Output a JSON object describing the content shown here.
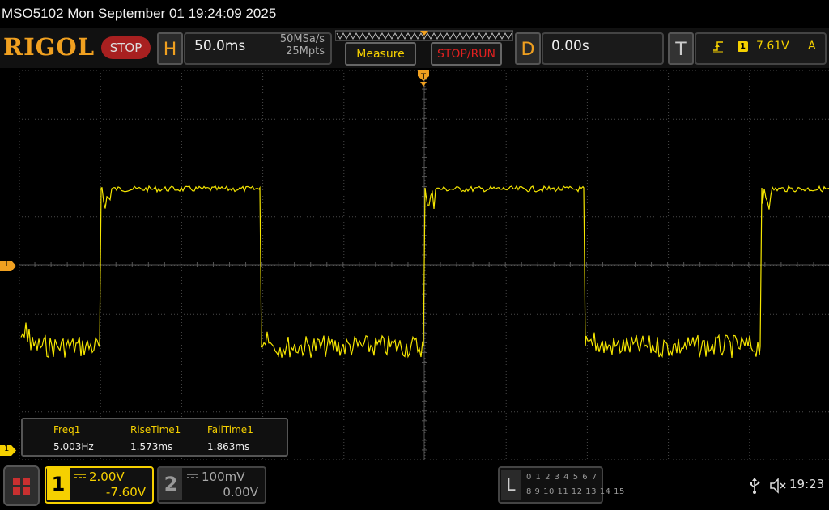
{
  "titlebar": {
    "text": "MSO5102  Mon September 01 19:24:09 2025"
  },
  "toolbar": {
    "logo": "RIGOL",
    "run_state": "STOP",
    "horizontal": {
      "key": "H",
      "timebase": "50.0ms",
      "sample_rate": "50MSa/s",
      "memory_depth": "25Mpts"
    },
    "measure_label": "Measure",
    "stop_run_label": "STOP/RUN",
    "delay": {
      "key": "D",
      "value": "0.00s"
    },
    "trigger": {
      "key": "T",
      "source": "1",
      "level": "7.61V",
      "mode": "A"
    }
  },
  "markers": {
    "trigger_level": "T",
    "ch1_ground": "1"
  },
  "measurements": [
    {
      "label": "Freq1",
      "value": "5.003Hz"
    },
    {
      "label": "RiseTime1",
      "value": "1.573ms"
    },
    {
      "label": "FallTime1",
      "value": "1.863ms"
    }
  ],
  "channels": [
    {
      "number": "1",
      "scale": "2.00V",
      "offset": "-7.60V"
    },
    {
      "number": "2",
      "scale": "100mV",
      "offset": "0.00V"
    }
  ],
  "logic_analyzer": {
    "key": "L",
    "row1": "0 1 2 3  4 5 6 7",
    "row2": "8 9 10 11 12 13 14 15"
  },
  "status": {
    "time": "19:23"
  },
  "colors": {
    "ch1": "#f5d000",
    "accent": "#f0a020",
    "stop": "#a82020",
    "grid": "#3a3a3a"
  },
  "icons": [
    "menu-grid-icon",
    "usb-icon",
    "speaker-muted-icon",
    "trigger-rising-edge-icon"
  ]
}
